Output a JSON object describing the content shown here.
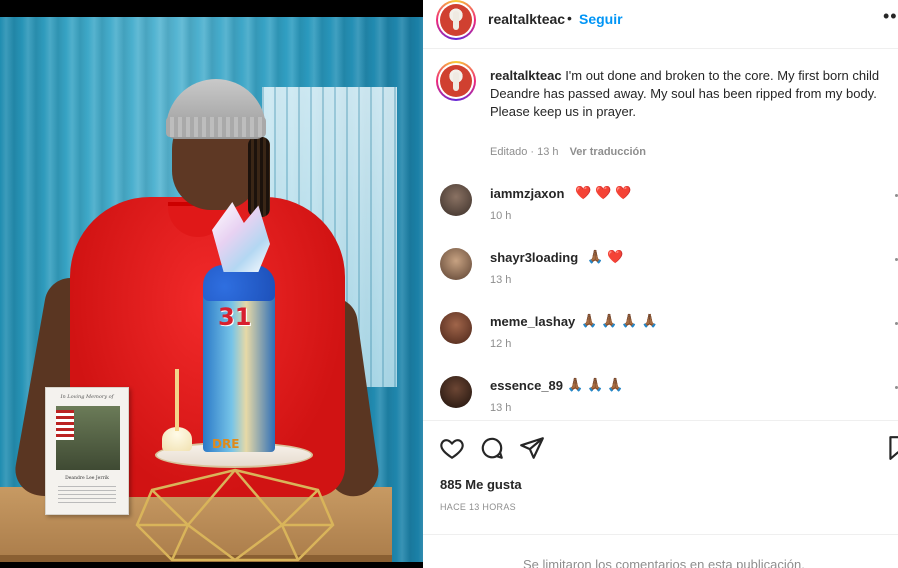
{
  "post": {
    "author": "realtalkteac",
    "separator": "•",
    "follow_label": "Seguir",
    "more_label": "••",
    "caption_line1": "I'm out done and broken to the core. My first born child Deandre has passed away. My soul has been ripped from my body.",
    "caption_line2": "Please keep us in prayer.",
    "edited": "Editado",
    "caption_time": "13 h",
    "translate_label": "Ver traducción",
    "photo": {
      "cake_number": "31",
      "cake_name": "DRE",
      "card_title": "In Loving Memory of",
      "card_name": "Deandre Lee Jerrik"
    }
  },
  "comments": [
    {
      "user": "iammzjaxon",
      "text": "❤️❤️❤️",
      "time": "10 h",
      "avatar_color": "#6b5a4e"
    },
    {
      "user": "shayr3loading",
      "text": "🙏🏾❤️",
      "time": "13 h",
      "avatar_color": "#9a7a5c"
    },
    {
      "user": "meme_lashay",
      "text": "🙏🏾🙏🏾🙏🏾🙏🏾",
      "time": "12 h",
      "avatar_color": "#7b4a36"
    },
    {
      "user": "essence_89",
      "text": "🙏🏾🙏🏾🙏🏾",
      "time": "13 h",
      "avatar_color": "#4a2f22"
    }
  ],
  "actions": {
    "like_icon": "heart-icon",
    "comment_icon": "comment-icon",
    "share_icon": "share-icon",
    "save_icon": "bookmark-icon"
  },
  "likes": "885 Me gusta",
  "posted_ago": "HACE 13 HORAS",
  "comments_limited": "Se limitaron los comentarios en esta publicación.",
  "colors": {
    "accent": "#0095f6",
    "muted": "#8e8e8e",
    "heart": "#ed4956"
  }
}
